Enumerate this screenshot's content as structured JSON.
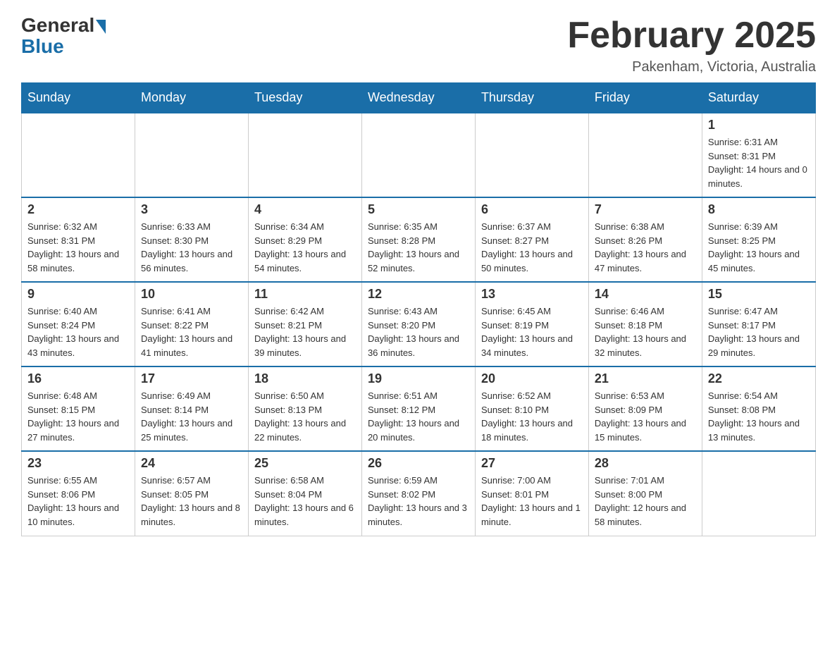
{
  "header": {
    "logo_general": "General",
    "logo_blue": "Blue",
    "month_title": "February 2025",
    "location": "Pakenham, Victoria, Australia"
  },
  "days_of_week": [
    "Sunday",
    "Monday",
    "Tuesday",
    "Wednesday",
    "Thursday",
    "Friday",
    "Saturday"
  ],
  "weeks": [
    [
      {
        "day": "",
        "info": ""
      },
      {
        "day": "",
        "info": ""
      },
      {
        "day": "",
        "info": ""
      },
      {
        "day": "",
        "info": ""
      },
      {
        "day": "",
        "info": ""
      },
      {
        "day": "",
        "info": ""
      },
      {
        "day": "1",
        "info": "Sunrise: 6:31 AM\nSunset: 8:31 PM\nDaylight: 14 hours and 0 minutes."
      }
    ],
    [
      {
        "day": "2",
        "info": "Sunrise: 6:32 AM\nSunset: 8:31 PM\nDaylight: 13 hours and 58 minutes."
      },
      {
        "day": "3",
        "info": "Sunrise: 6:33 AM\nSunset: 8:30 PM\nDaylight: 13 hours and 56 minutes."
      },
      {
        "day": "4",
        "info": "Sunrise: 6:34 AM\nSunset: 8:29 PM\nDaylight: 13 hours and 54 minutes."
      },
      {
        "day": "5",
        "info": "Sunrise: 6:35 AM\nSunset: 8:28 PM\nDaylight: 13 hours and 52 minutes."
      },
      {
        "day": "6",
        "info": "Sunrise: 6:37 AM\nSunset: 8:27 PM\nDaylight: 13 hours and 50 minutes."
      },
      {
        "day": "7",
        "info": "Sunrise: 6:38 AM\nSunset: 8:26 PM\nDaylight: 13 hours and 47 minutes."
      },
      {
        "day": "8",
        "info": "Sunrise: 6:39 AM\nSunset: 8:25 PM\nDaylight: 13 hours and 45 minutes."
      }
    ],
    [
      {
        "day": "9",
        "info": "Sunrise: 6:40 AM\nSunset: 8:24 PM\nDaylight: 13 hours and 43 minutes."
      },
      {
        "day": "10",
        "info": "Sunrise: 6:41 AM\nSunset: 8:22 PM\nDaylight: 13 hours and 41 minutes."
      },
      {
        "day": "11",
        "info": "Sunrise: 6:42 AM\nSunset: 8:21 PM\nDaylight: 13 hours and 39 minutes."
      },
      {
        "day": "12",
        "info": "Sunrise: 6:43 AM\nSunset: 8:20 PM\nDaylight: 13 hours and 36 minutes."
      },
      {
        "day": "13",
        "info": "Sunrise: 6:45 AM\nSunset: 8:19 PM\nDaylight: 13 hours and 34 minutes."
      },
      {
        "day": "14",
        "info": "Sunrise: 6:46 AM\nSunset: 8:18 PM\nDaylight: 13 hours and 32 minutes."
      },
      {
        "day": "15",
        "info": "Sunrise: 6:47 AM\nSunset: 8:17 PM\nDaylight: 13 hours and 29 minutes."
      }
    ],
    [
      {
        "day": "16",
        "info": "Sunrise: 6:48 AM\nSunset: 8:15 PM\nDaylight: 13 hours and 27 minutes."
      },
      {
        "day": "17",
        "info": "Sunrise: 6:49 AM\nSunset: 8:14 PM\nDaylight: 13 hours and 25 minutes."
      },
      {
        "day": "18",
        "info": "Sunrise: 6:50 AM\nSunset: 8:13 PM\nDaylight: 13 hours and 22 minutes."
      },
      {
        "day": "19",
        "info": "Sunrise: 6:51 AM\nSunset: 8:12 PM\nDaylight: 13 hours and 20 minutes."
      },
      {
        "day": "20",
        "info": "Sunrise: 6:52 AM\nSunset: 8:10 PM\nDaylight: 13 hours and 18 minutes."
      },
      {
        "day": "21",
        "info": "Sunrise: 6:53 AM\nSunset: 8:09 PM\nDaylight: 13 hours and 15 minutes."
      },
      {
        "day": "22",
        "info": "Sunrise: 6:54 AM\nSunset: 8:08 PM\nDaylight: 13 hours and 13 minutes."
      }
    ],
    [
      {
        "day": "23",
        "info": "Sunrise: 6:55 AM\nSunset: 8:06 PM\nDaylight: 13 hours and 10 minutes."
      },
      {
        "day": "24",
        "info": "Sunrise: 6:57 AM\nSunset: 8:05 PM\nDaylight: 13 hours and 8 minutes."
      },
      {
        "day": "25",
        "info": "Sunrise: 6:58 AM\nSunset: 8:04 PM\nDaylight: 13 hours and 6 minutes."
      },
      {
        "day": "26",
        "info": "Sunrise: 6:59 AM\nSunset: 8:02 PM\nDaylight: 13 hours and 3 minutes."
      },
      {
        "day": "27",
        "info": "Sunrise: 7:00 AM\nSunset: 8:01 PM\nDaylight: 13 hours and 1 minute."
      },
      {
        "day": "28",
        "info": "Sunrise: 7:01 AM\nSunset: 8:00 PM\nDaylight: 12 hours and 58 minutes."
      },
      {
        "day": "",
        "info": ""
      }
    ]
  ]
}
